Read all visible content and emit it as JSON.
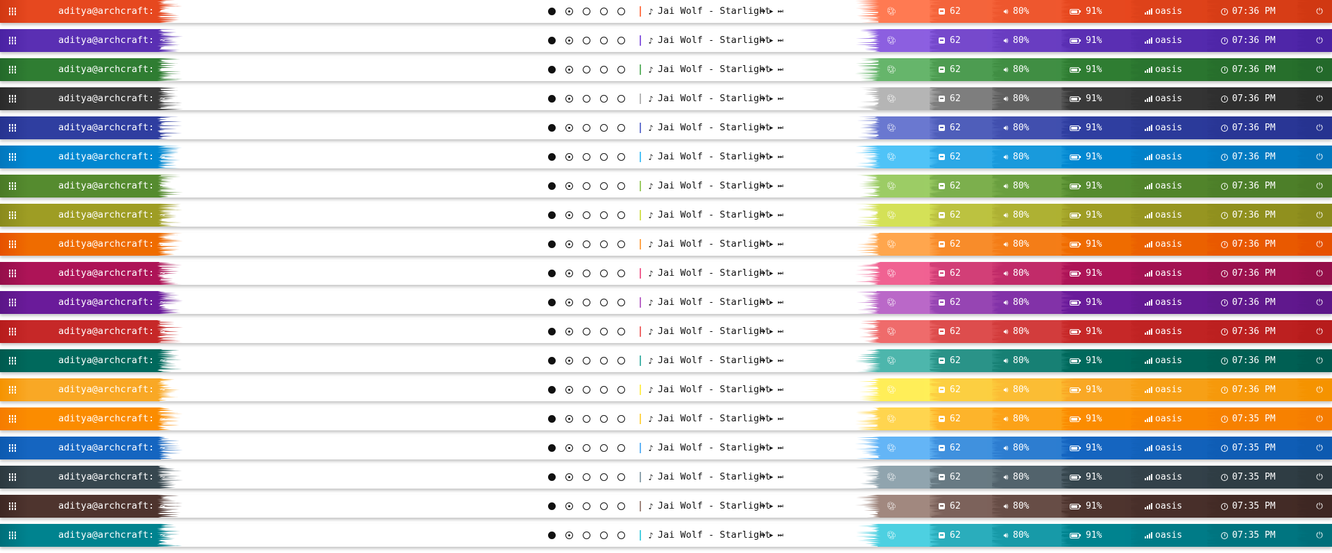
{
  "bar_template": {
    "user_host": "aditya@archcraft: ~",
    "workspaces": [
      {
        "state": "active"
      },
      {
        "state": "current"
      },
      {
        "state": "empty"
      },
      {
        "state": "empty"
      },
      {
        "state": "empty"
      }
    ],
    "song": "Jai Wolf - Starlight",
    "updates": "62",
    "volume": "80%",
    "battery": "91%",
    "network": "oasis"
  },
  "bars": [
    {
      "accent": "#e6481f",
      "dark": "#d13812",
      "light": "#ff7a52",
      "time": "07:36 PM"
    },
    {
      "accent": "#5a2fb3",
      "dark": "#4a22a3",
      "light": "#8c5fe0",
      "time": "07:36 PM"
    },
    {
      "accent": "#2f7d32",
      "dark": "#23692a",
      "light": "#66b56b",
      "time": "07:36 PM"
    },
    {
      "accent": "#3a3a3a",
      "dark": "#2a2a2a",
      "light": "#b5b5b5",
      "time": "07:36 PM"
    },
    {
      "accent": "#2f3ea0",
      "dark": "#263390",
      "light": "#6a78d0",
      "time": "07:36 PM"
    },
    {
      "accent": "#0288d1",
      "dark": "#0277bd",
      "light": "#4fc3f7",
      "time": "07:36 PM"
    },
    {
      "accent": "#558b2f",
      "dark": "#4a7a26",
      "light": "#9ccc65",
      "time": "07:36 PM"
    },
    {
      "accent": "#9e9d24",
      "dark": "#8a8a1c",
      "light": "#d4e157",
      "time": "07:36 PM"
    },
    {
      "accent": "#ef6c00",
      "dark": "#e65100",
      "light": "#ffa64d",
      "time": "07:36 PM"
    },
    {
      "accent": "#ad1457",
      "dark": "#950f4a",
      "light": "#f06292",
      "time": "07:36 PM"
    },
    {
      "accent": "#6a1b9a",
      "dark": "#5c1688",
      "light": "#ba68c8",
      "time": "07:36 PM"
    },
    {
      "accent": "#c62828",
      "dark": "#b71c1c",
      "light": "#ef6b6b",
      "time": "07:36 PM"
    },
    {
      "accent": "#00695c",
      "dark": "#005a4f",
      "light": "#4db6ac",
      "time": "07:36 PM"
    },
    {
      "accent": "#f9a825",
      "dark": "#f59300",
      "light": "#ffee58",
      "time": "07:36 PM"
    },
    {
      "accent": "#fb8c00",
      "dark": "#f57c00",
      "light": "#ffd54f",
      "time": "07:35 PM"
    },
    {
      "accent": "#1565c0",
      "dark": "#0d5ab0",
      "light": "#64b5f6",
      "time": "07:35 PM"
    },
    {
      "accent": "#37474f",
      "dark": "#2c393f",
      "light": "#90a4ae",
      "time": "07:35 PM"
    },
    {
      "accent": "#4e342e",
      "dark": "#3e2723",
      "light": "#a1887f",
      "time": "07:35 PM"
    },
    {
      "accent": "#00838f",
      "dark": "#006f7a",
      "light": "#4dd0e1",
      "time": "07:35 PM"
    }
  ],
  "icons": {
    "menu": "grid-dots-icon",
    "music": "music-note-icon",
    "prev": "previous-track-icon",
    "play": "play-icon",
    "next": "next-track-icon",
    "palette": "palette-icon",
    "updates": "package-icon",
    "volume": "volume-icon",
    "battery": "battery-icon",
    "network": "wifi-signal-icon",
    "clock": "clock-icon",
    "power": "power-icon"
  }
}
